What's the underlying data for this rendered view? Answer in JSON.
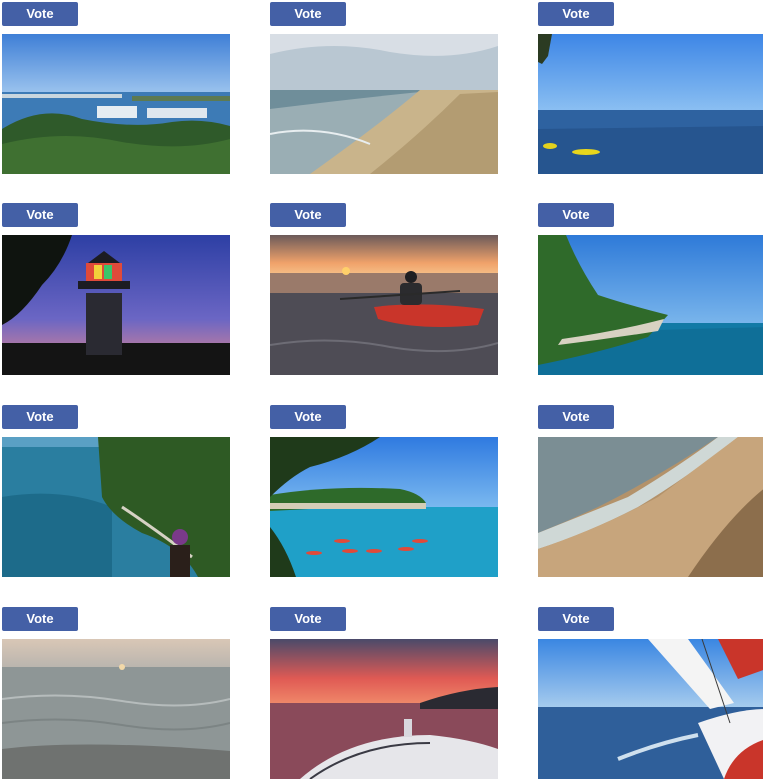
{
  "gallery": {
    "vote_label": "Vote",
    "accent_color": "#4460a6",
    "photos": [
      {
        "subject": "harbor-view"
      },
      {
        "subject": "sandy-shoreline"
      },
      {
        "subject": "lake-with-kayaks"
      },
      {
        "subject": "lighthouse-at-dusk"
      },
      {
        "subject": "kayaker-at-sunset"
      },
      {
        "subject": "cliffs-and-turquoise-water"
      },
      {
        "subject": "cliff-overlook-person"
      },
      {
        "subject": "kayakers-near-cliffs"
      },
      {
        "subject": "beach-waves"
      },
      {
        "subject": "calm-lake-sunset"
      },
      {
        "subject": "boat-sunset"
      },
      {
        "subject": "sailboat-on-lake"
      }
    ]
  }
}
